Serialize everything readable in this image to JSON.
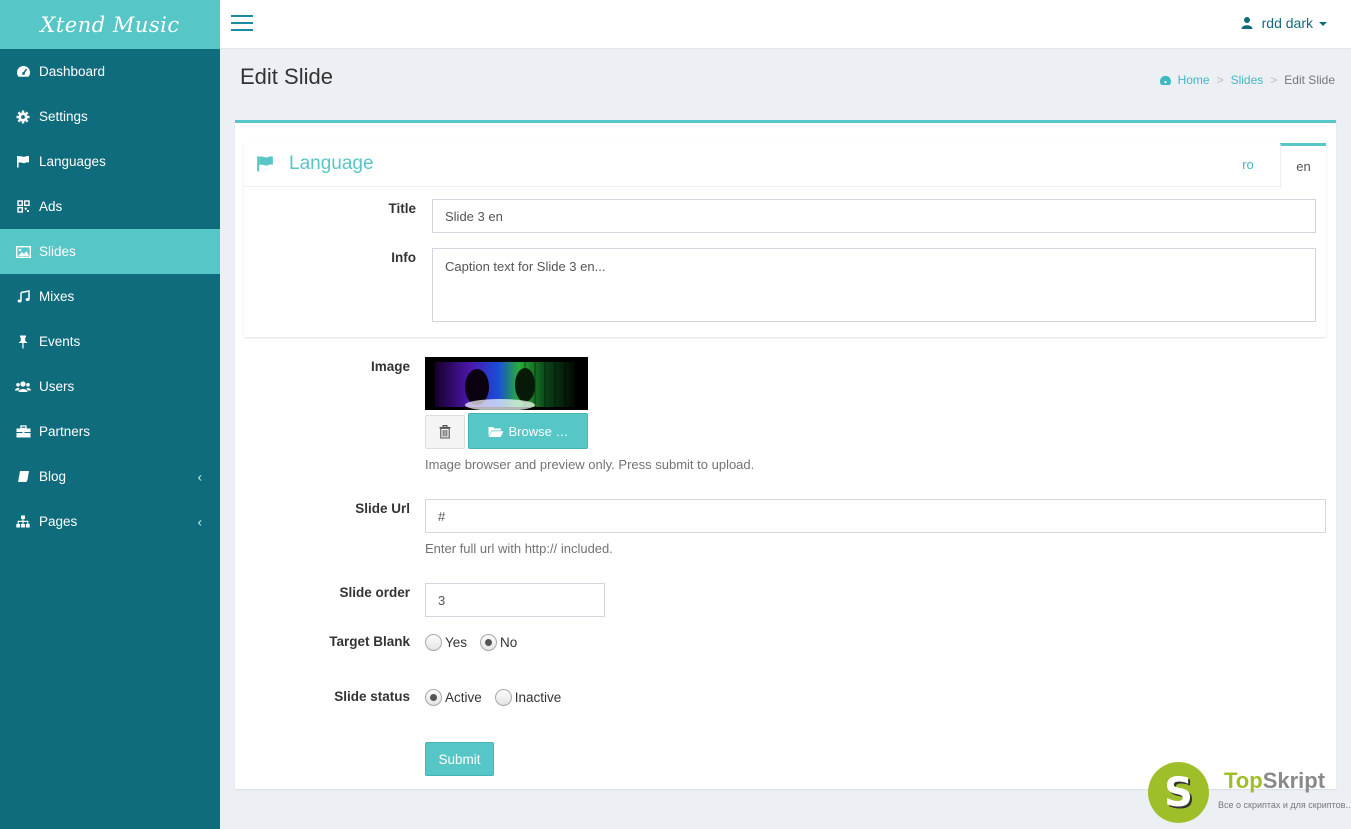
{
  "app": {
    "brand": "Xtend Music"
  },
  "sidebar": {
    "items": [
      {
        "label": "Dashboard",
        "icon": "dashboard-icon"
      },
      {
        "label": "Settings",
        "icon": "gear-icon"
      },
      {
        "label": "Languages",
        "icon": "flag-icon"
      },
      {
        "label": "Ads",
        "icon": "qrcode-icon"
      },
      {
        "label": "Slides",
        "icon": "image-icon",
        "active": true
      },
      {
        "label": "Mixes",
        "icon": "music-icon"
      },
      {
        "label": "Events",
        "icon": "pin-icon"
      },
      {
        "label": "Users",
        "icon": "users-icon"
      },
      {
        "label": "Partners",
        "icon": "briefcase-icon"
      },
      {
        "label": "Blog",
        "icon": "book-icon",
        "expandable": true
      },
      {
        "label": "Pages",
        "icon": "sitemap-icon",
        "expandable": true
      }
    ]
  },
  "topbar": {
    "user_name": "rdd dark"
  },
  "page": {
    "title": "Edit Slide",
    "breadcrumb": [
      "Home",
      "Slides",
      "Edit Slide"
    ]
  },
  "language_panel": {
    "title": "Language",
    "tabs": [
      {
        "label": "ro"
      },
      {
        "label": "en",
        "active": true
      }
    ]
  },
  "form": {
    "title_label": "Title",
    "title_value": "Slide 3 en",
    "info_label": "Info",
    "info_value": "Caption text for Slide 3 en...",
    "image_label": "Image",
    "browse_label": "Browse …",
    "image_help": "Image browser and preview only. Press submit to upload.",
    "url_label": "Slide Url",
    "url_value": "#",
    "url_help": "Enter full url with http:// included.",
    "order_label": "Slide order",
    "order_value": "3",
    "target_label": "Target Blank",
    "target_options": [
      "Yes",
      "No"
    ],
    "target_selected": "No",
    "status_label": "Slide status",
    "status_options": [
      "Active",
      "Inactive"
    ],
    "status_selected": "Active",
    "submit_label": "Submit"
  },
  "watermark": {
    "brand_prefix": "Top",
    "brand_suffix": "Skript",
    "tagline": "Все о скриптах и для скриптов..."
  },
  "colors": {
    "sidebar": "#0f6c7c",
    "accent": "#57c6c7",
    "link": "#3fb8c2"
  }
}
